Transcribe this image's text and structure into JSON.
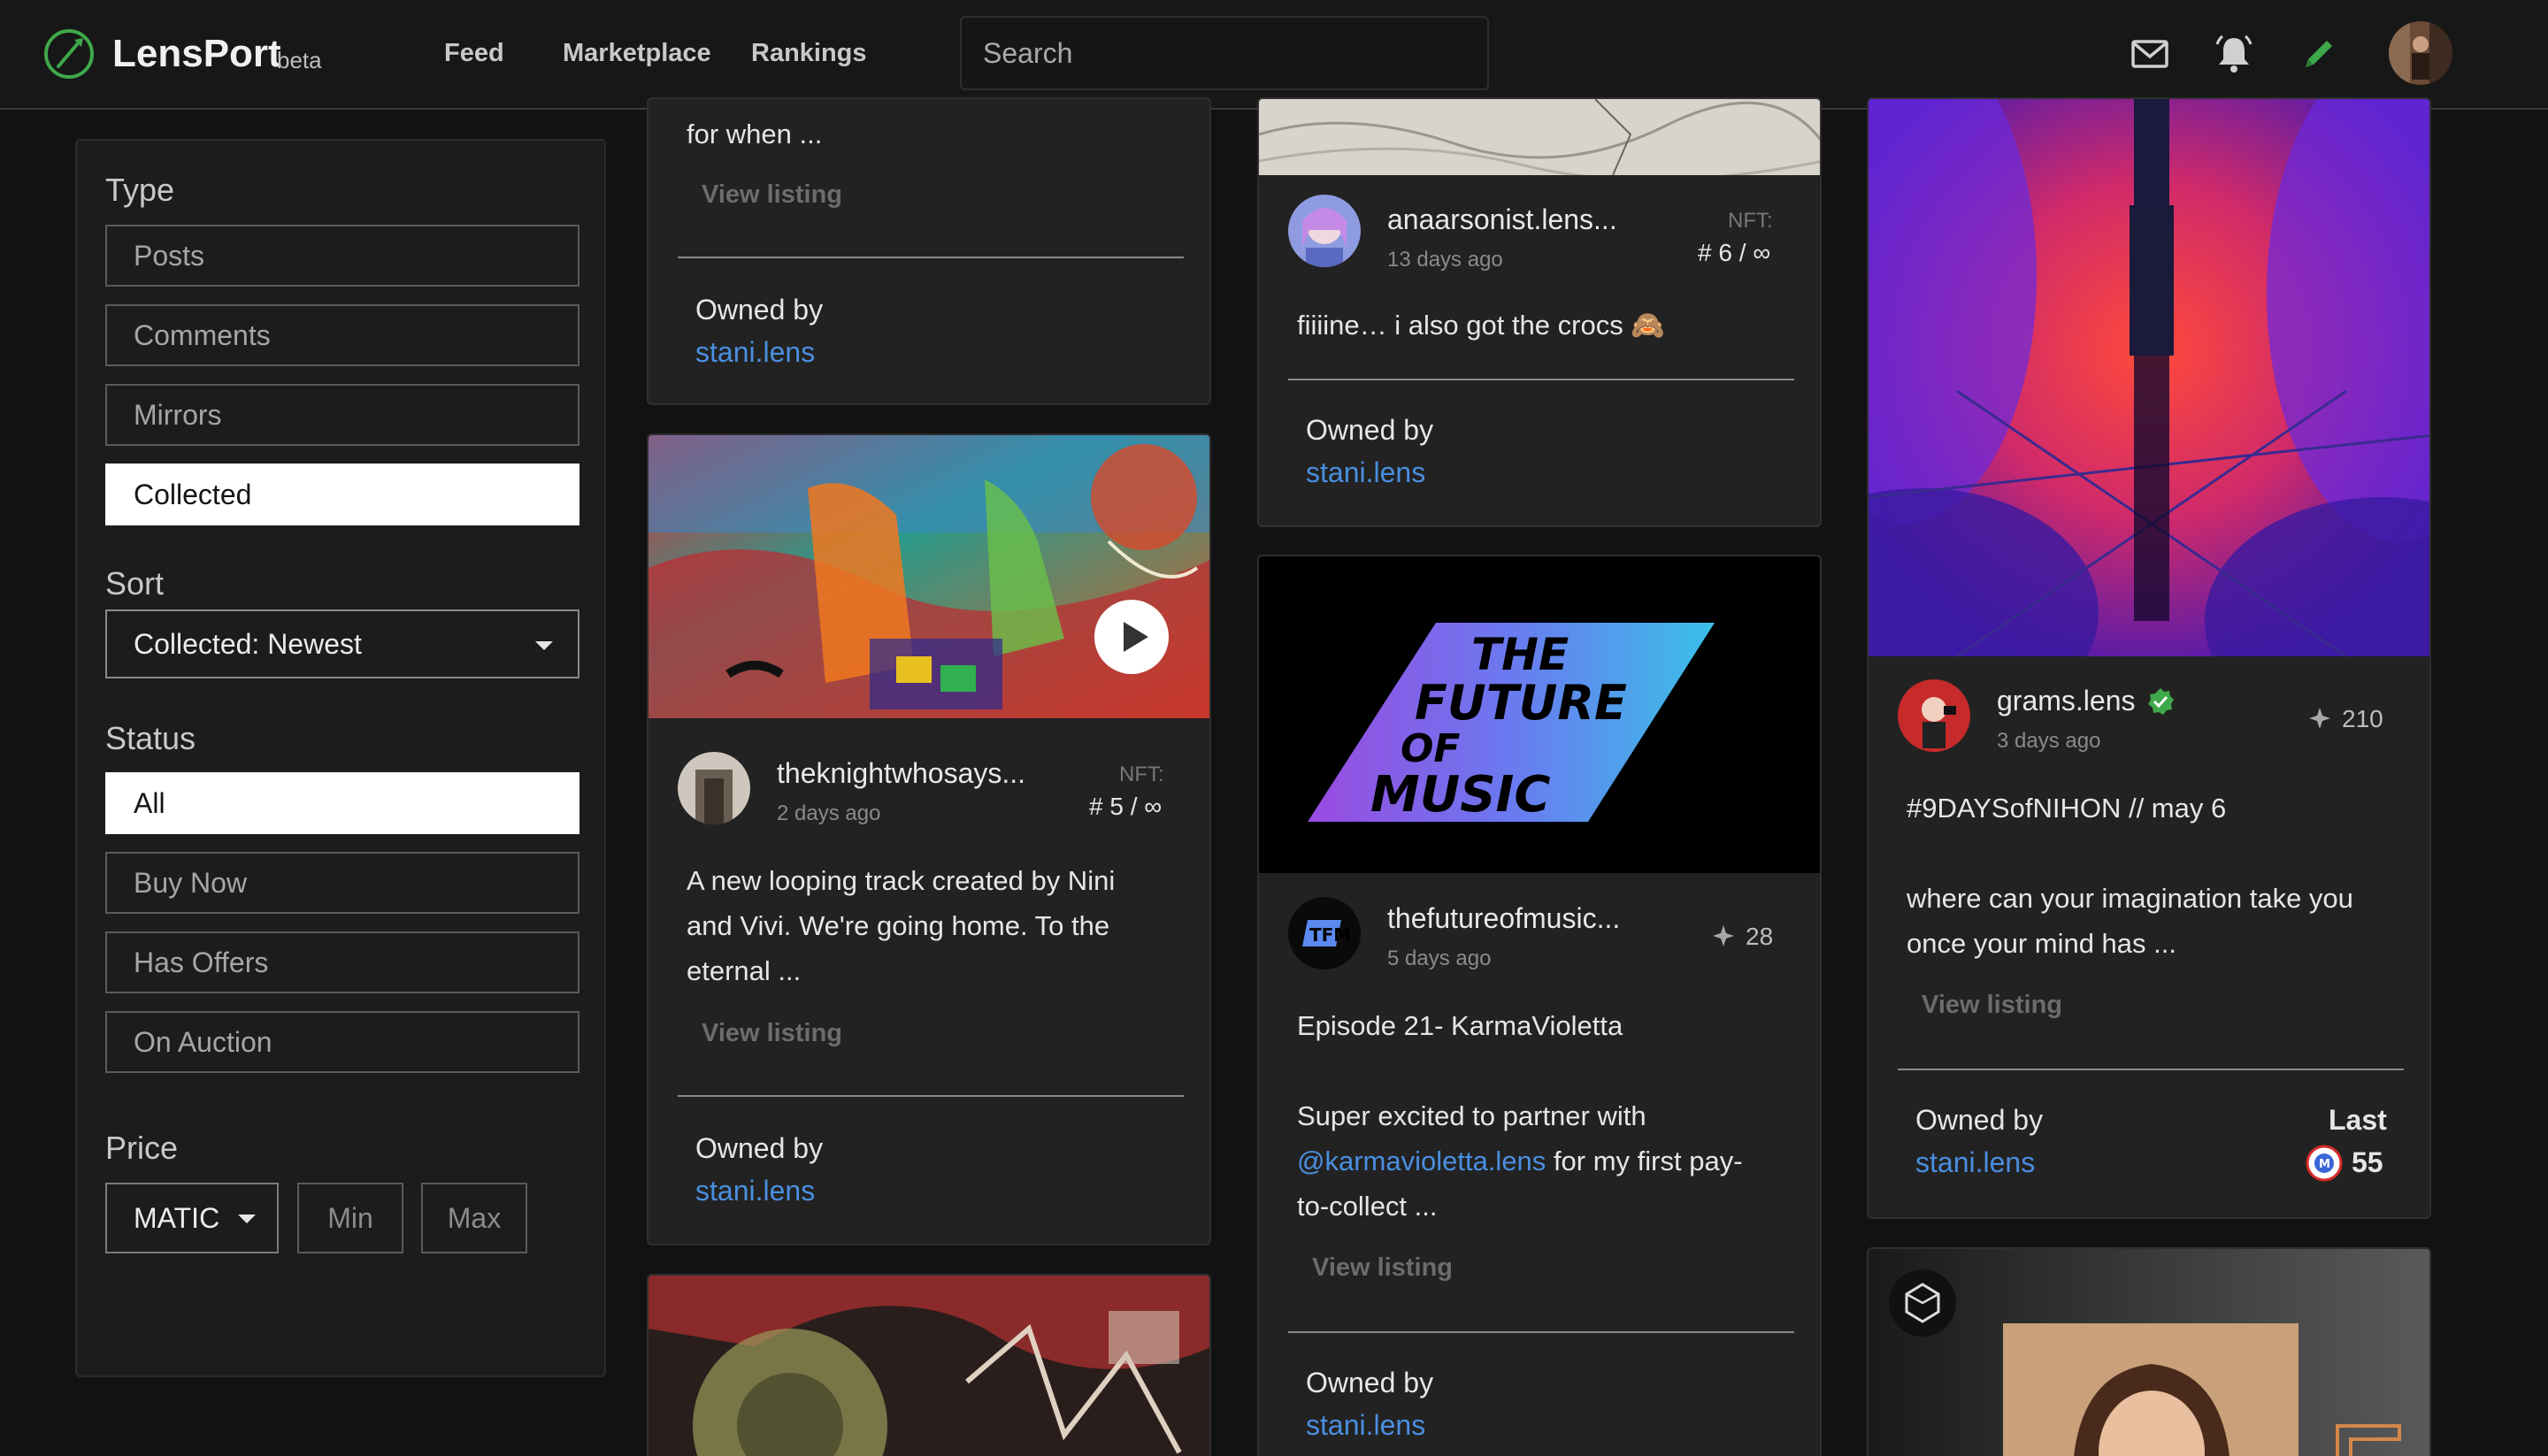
{
  "header": {
    "logo": "LensPort",
    "beta": "beta",
    "nav": [
      "Feed",
      "Marketplace",
      "Rankings"
    ],
    "search_placeholder": "Search"
  },
  "colors": {
    "accent_green": "#3fa84a",
    "link_blue": "#4a8fe0",
    "background": "#121212",
    "card": "#222222"
  },
  "icons": [
    "logo-icon",
    "mail-icon",
    "bell-icon",
    "pencil-icon",
    "play-icon",
    "sparkle-icon",
    "verified-icon",
    "matic-icon",
    "hexagon-icon"
  ],
  "filters": {
    "type_label": "Type",
    "types": [
      "Posts",
      "Comments",
      "Mirrors",
      "Collected"
    ],
    "sort_label": "Sort",
    "sort_value": "Collected: Newest",
    "status_label": "Status",
    "statuses": [
      "All",
      "Buy Now",
      "Has Offers",
      "On Auction"
    ],
    "price_label": "Price",
    "currency": "MATIC",
    "min_placeholder": "Min",
    "max_placeholder": "Max"
  },
  "cards": {
    "c1": {
      "snippet": "for when ...",
      "view": "View listing",
      "owned_label": "Owned by",
      "owner": "stani.lens"
    },
    "c2": {
      "user": "theknightwhosays...",
      "time": "2 days ago",
      "nft_label": "NFT:",
      "edition": "# 5 / ∞",
      "body": [
        "A new looping track created by Nini",
        "and Vivi. We're going home. To the",
        "eternal ..."
      ],
      "view": "View listing",
      "owned_label": "Owned by",
      "owner": "stani.lens"
    },
    "c4": {
      "user": "anaarsonist.lens...",
      "time": "13 days ago",
      "nft_label": "NFT:",
      "edition": "# 6 / ∞",
      "body": "fiiiine… i also got the crocs 🙈",
      "owned_label": "Owned by",
      "owner": "stani.lens"
    },
    "c5": {
      "user": "thefutureofmusic...",
      "time": "5 days ago",
      "collects": "28",
      "title": "Episode 21- KarmaVioletta",
      "body_pre": "Super excited to partner with",
      "mention": "@karmavioletta.lens",
      "body_mid": "for my first pay-",
      "body_post": "to-collect ...",
      "view": "View listing",
      "owned_label": "Owned by",
      "owner": "stani.lens",
      "art_text": [
        "THE",
        "FUTURE",
        "OF",
        "MUSIC"
      ]
    },
    "c7": {
      "user": "grams.lens",
      "time": "3 days ago",
      "collects": "210",
      "title": "#9DAYSofNIHON // may 6",
      "body": [
        "where can your imagination take you",
        "once your mind has ..."
      ],
      "view": "View listing",
      "owned_label": "Owned by",
      "owner": "stani.lens",
      "last_label": "Last",
      "last_value": "55"
    }
  }
}
